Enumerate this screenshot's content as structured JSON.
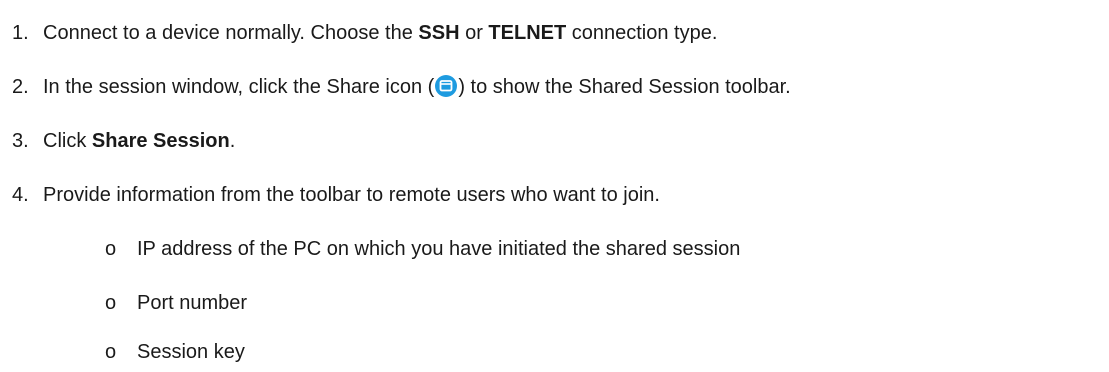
{
  "steps": [
    {
      "number": "1.",
      "parts": [
        "Connect to a device normally. Choose the ",
        "SSH",
        " or ",
        "TELNET",
        " connection type."
      ]
    },
    {
      "number": "2.",
      "before_icon": "In the session window, click the Share icon (",
      "icon": "share-icon",
      "after_icon": ") to show the Shared Session toolbar."
    },
    {
      "number": "3.",
      "parts": [
        "Click ",
        "Share Session",
        "."
      ]
    },
    {
      "number": "4.",
      "text": "Provide information from the toolbar to remote users who want to join."
    }
  ],
  "sub_items": [
    {
      "bullet": "o",
      "text": "IP address of the PC on which you have initiated the shared session"
    },
    {
      "bullet": "o",
      "text": "Port number"
    },
    {
      "bullet": "o",
      "text": "Session key"
    }
  ],
  "colors": {
    "text": "#1a1a1a",
    "icon_fill": "#1e9be0"
  }
}
